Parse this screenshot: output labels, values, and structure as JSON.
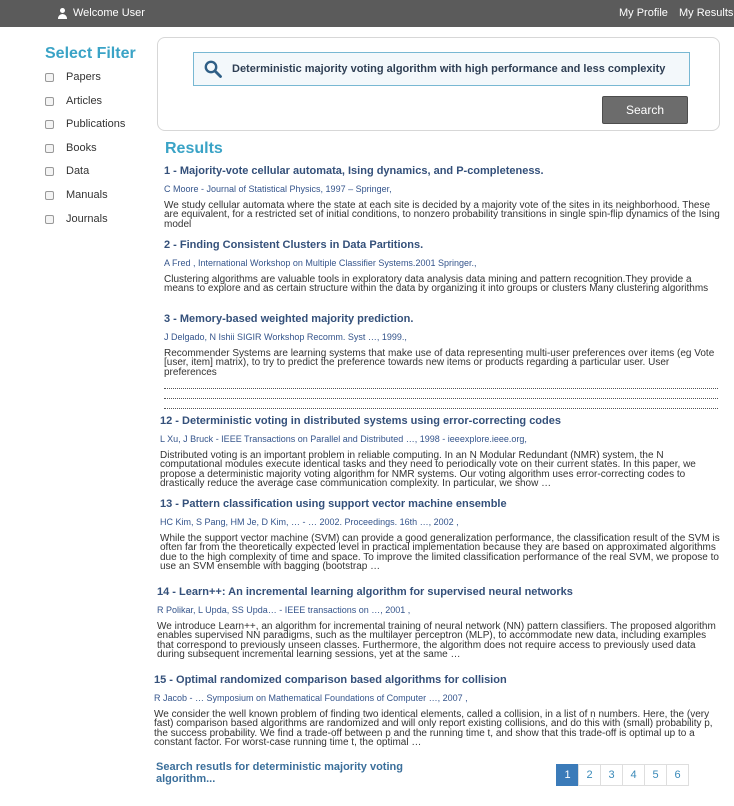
{
  "topbar": {
    "welcome": "Welcome User",
    "my_profile": "My Profile",
    "my_results": "My Results"
  },
  "filter": {
    "title": "Select Filter",
    "items": [
      "Papers",
      "Articles",
      "Publications",
      "Books",
      "Data",
      "Manuals",
      "Journals"
    ]
  },
  "search": {
    "query": "Deterministic majority voting algorithm with high performance and less complexity",
    "button": "Search"
  },
  "results": {
    "title": "Results",
    "items": [
      {
        "title": "1 - Majority-vote cellular automata, Ising dynamics, and P-completeness.",
        "authors": "C Moore - Journal of Statistical Physics, 1997 – Springer,",
        "snippet": "We study cellular automata where the state at each site is decided by a majority vote of the sites in its neighborhood. These are equivalent, for a restricted set of initial conditions, to nonzero probability transitions in single spin-flip dynamics of the Ising model"
      },
      {
        "title": "2 - Finding Consistent Clusters in Data Partitions.",
        "authors": "A Fred , International Workshop on Multiple Classifier Systems.2001 Springer.,",
        "snippet": "Clustering algorithms are valuable tools in exploratory data analysis data mining and pattern recognition.They provide a means to explore and as certain structure within the data by organizing it into groups or clusters Many clustering algorithms"
      },
      {
        "title": "3 - Memory-based weighted majority prediction.",
        "authors": "J Delgado, N Ishii SIGIR Workshop Recomm. Syst …, 1999.,",
        "snippet": "Recommender Systems are learning systems that make use of data representing multi-user preferences over items (eg Vote [user, item] matrix), to try to predict the preference towards new items or products regarding a particular user. User preferences"
      },
      {
        "title": "12 - Deterministic voting in distributed systems using error-correcting codes",
        "authors": "L Xu, J Bruck - IEEE Transactions on Parallel and Distributed …, 1998 - ieeexplore.ieee.org,",
        "snippet": "Distributed voting is an important problem in reliable computing. In an N Modular Redundant (NMR) system, the N computational modules execute identical tasks and they need to periodically vote on their current states. In this paper, we propose a deterministic majority voting algorithm for NMR systems. Our voting algorithm uses error-correcting codes to drastically reduce the average case communication complexity. In particular, we show …"
      },
      {
        "title": "13 - Pattern classification using support vector machine ensemble",
        "authors": "HC Kim, S Pang, HM Je, D Kim, … - … 2002. Proceedings. 16th …, 2002 ,",
        "snippet": "While the support vector machine (SVM) can provide a good generalization performance, the classification result of the SVM is often far from the theoretically expected level in practical implementation because they are based on approximated algorithms due to the high complexity of time and space. To improve the limited classification performance of the real SVM, we propose to use an SVM ensemble with bagging (bootstrap …"
      },
      {
        "title": "14 - Learn++: An incremental learning algorithm for supervised neural networks",
        "authors": "R Polikar, L Upda, SS Upda… - IEEE transactions on …, 2001 ,",
        "snippet": "We introduce Learn++, an algorithm for incremental training of neural network (NN) pattern classifiers. The proposed algorithm enables supervised NN paradigms, such as the multilayer perceptron (MLP), to accommodate new data, including examples that correspond to previously unseen classes. Furthermore, the algorithm does not require access to previously used data during subsequent incremental learning sessions, yet at the same …"
      },
      {
        "title": "15 - Optimal randomized comparison based algorithms for collision",
        "authors": "R Jacob - … Symposium on Mathematical Foundations of Computer …, 2007 ,",
        "snippet": "We consider the well known problem of finding two identical elements, called a collision, in a list of n numbers. Here, the (very fast) comparison based algorithms are randomized and will only report existing collisions, and do this with (small) probability p, the success probability. We find a trade-off between p and the running time t, and show that this trade-off is optimal up to a constant factor. For worst-case running time t, the optimal …"
      }
    ]
  },
  "footer": {
    "search_results_link": "Search resutls for deterministic majority voting algorithm..."
  },
  "pagination": {
    "pages": [
      "1",
      "2",
      "3",
      "4",
      "5",
      "6"
    ],
    "current": "1"
  }
}
